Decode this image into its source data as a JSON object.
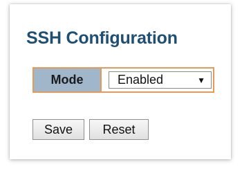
{
  "page": {
    "title": "SSH Configuration"
  },
  "mode": {
    "label": "Mode",
    "selected_value": "Enabled",
    "dropdown_icon": "chevron-down-icon"
  },
  "buttons": {
    "save_label": "Save",
    "reset_label": "Reset"
  },
  "colors": {
    "title": "#1f4f73",
    "label_background": "#9fb6cb",
    "row_border": "#e79a57"
  }
}
